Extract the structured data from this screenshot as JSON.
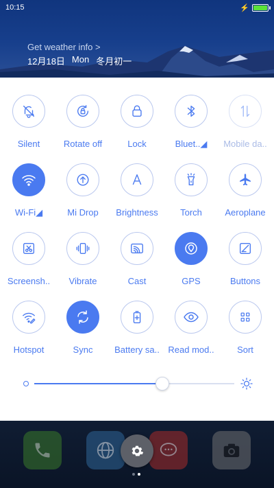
{
  "status": {
    "time": "10:15"
  },
  "header": {
    "weather_link": "Get weather info >",
    "date": "12月18日",
    "weekday": "Mon",
    "lunar": "冬月初一"
  },
  "tiles": [
    {
      "label": "Silent",
      "icon": "bell-off-icon",
      "active": false
    },
    {
      "label": "Rotate off",
      "icon": "rotate-lock-icon",
      "active": false
    },
    {
      "label": "Lock",
      "icon": "lock-icon",
      "active": false
    },
    {
      "label": "Bluet..◢",
      "icon": "bluetooth-icon",
      "active": false
    },
    {
      "label": "Mobile da..",
      "icon": "mobile-data-icon",
      "active": false,
      "disabled": true
    },
    {
      "label": "Wi-Fi◢",
      "icon": "wifi-icon",
      "active": true
    },
    {
      "label": "Mi Drop",
      "icon": "upload-circle-icon",
      "active": false
    },
    {
      "label": "Brightness",
      "icon": "brightness-a-icon",
      "active": false
    },
    {
      "label": "Torch",
      "icon": "torch-icon",
      "active": false
    },
    {
      "label": "Aeroplane",
      "icon": "airplane-icon",
      "active": false
    },
    {
      "label": "Screensh..",
      "icon": "scissors-icon",
      "active": false
    },
    {
      "label": "Vibrate",
      "icon": "vibrate-icon",
      "active": false
    },
    {
      "label": "Cast",
      "icon": "cast-icon",
      "active": false
    },
    {
      "label": "GPS",
      "icon": "gps-icon",
      "active": true
    },
    {
      "label": "Buttons",
      "icon": "buttons-icon",
      "active": false
    },
    {
      "label": "Hotspot",
      "icon": "hotspot-icon",
      "active": false
    },
    {
      "label": "Sync",
      "icon": "sync-icon",
      "active": true
    },
    {
      "label": "Battery sa..",
      "icon": "battery-saver-icon",
      "active": false
    },
    {
      "label": "Read mod..",
      "icon": "eye-icon",
      "active": false
    },
    {
      "label": "Sort",
      "icon": "grid-icon",
      "active": false
    }
  ],
  "brightness": {
    "level": 0.64
  },
  "dock": {
    "apps": [
      "phone-icon",
      "browser-icon",
      "messages-icon",
      "camera-icon"
    ],
    "pages": 2,
    "current_page": 2
  },
  "colors": {
    "accent": "#4a7af0"
  }
}
